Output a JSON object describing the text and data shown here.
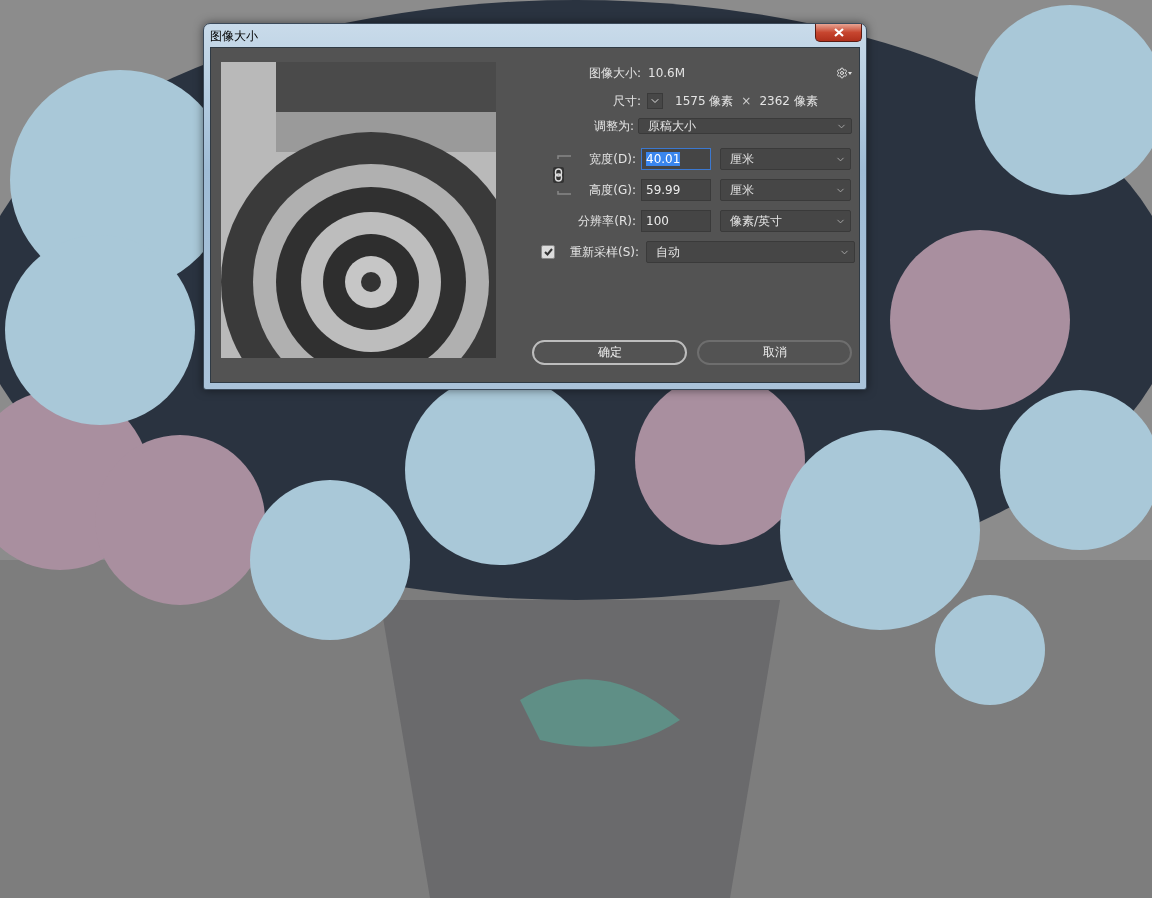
{
  "window": {
    "title": "图像大小"
  },
  "image_size": {
    "label": "图像大小:",
    "value": "10.6M"
  },
  "dimensions": {
    "label": "尺寸:",
    "width": "1575 像素",
    "separator": "×",
    "height": "2362 像素"
  },
  "fit_to": {
    "label": "调整为:",
    "value": "原稿大小"
  },
  "constrain_proportions": {
    "on": true
  },
  "fields": [
    {
      "label": "宽度(D):",
      "value": "40.01",
      "selected": true,
      "unit": "厘米"
    },
    {
      "label": "高度(G):",
      "value": "59.99",
      "selected": false,
      "unit": "厘米"
    },
    {
      "label": "分辨率(R):",
      "value": "100",
      "selected": false,
      "unit": "像素/英寸"
    }
  ],
  "resample": {
    "label": "重新采样(S):",
    "checked": true,
    "value": "自动"
  },
  "buttons": [
    {
      "label": "确定",
      "kind": "default"
    },
    {
      "label": "取消",
      "kind": "normal"
    }
  ]
}
